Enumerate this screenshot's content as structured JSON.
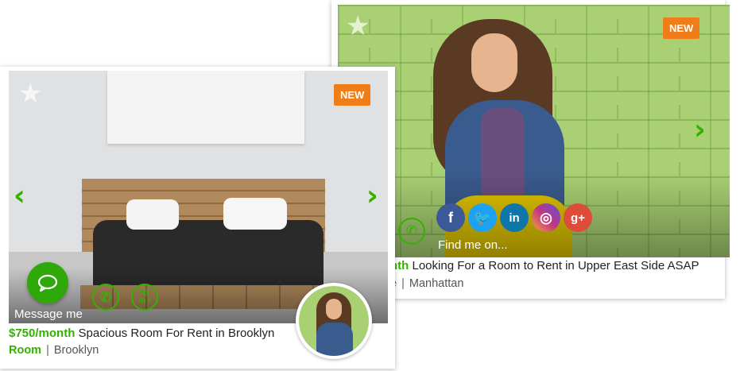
{
  "cards": {
    "back": {
      "badge": "NEW",
      "title_price_fragment": "nth",
      "title": "Looking For a Room to Rent in Upper East Side ASAP",
      "type_fragment": "e",
      "location": "Manhattan",
      "find_me_label": "Find me on...",
      "social": [
        {
          "icon": "facebook-icon",
          "glyph": "f",
          "color": "#3b5998"
        },
        {
          "icon": "twitter-icon",
          "glyph": "t",
          "color": "#1da1f2"
        },
        {
          "icon": "linkedin-icon",
          "glyph": "in",
          "color": "#0e76a8"
        },
        {
          "icon": "instagram-icon",
          "glyph": "◎",
          "color": "#c13584"
        },
        {
          "icon": "google-plus-icon",
          "glyph": "g+",
          "color": "#dd4b39"
        }
      ]
    },
    "front": {
      "badge": "NEW",
      "price": "$750/month",
      "title": "Spacious Room For Rent in Brooklyn",
      "type": "Room",
      "location": "Brooklyn",
      "message_label": "Message me"
    }
  },
  "colors": {
    "accent": "#35b000",
    "badge": "#f07d17"
  }
}
